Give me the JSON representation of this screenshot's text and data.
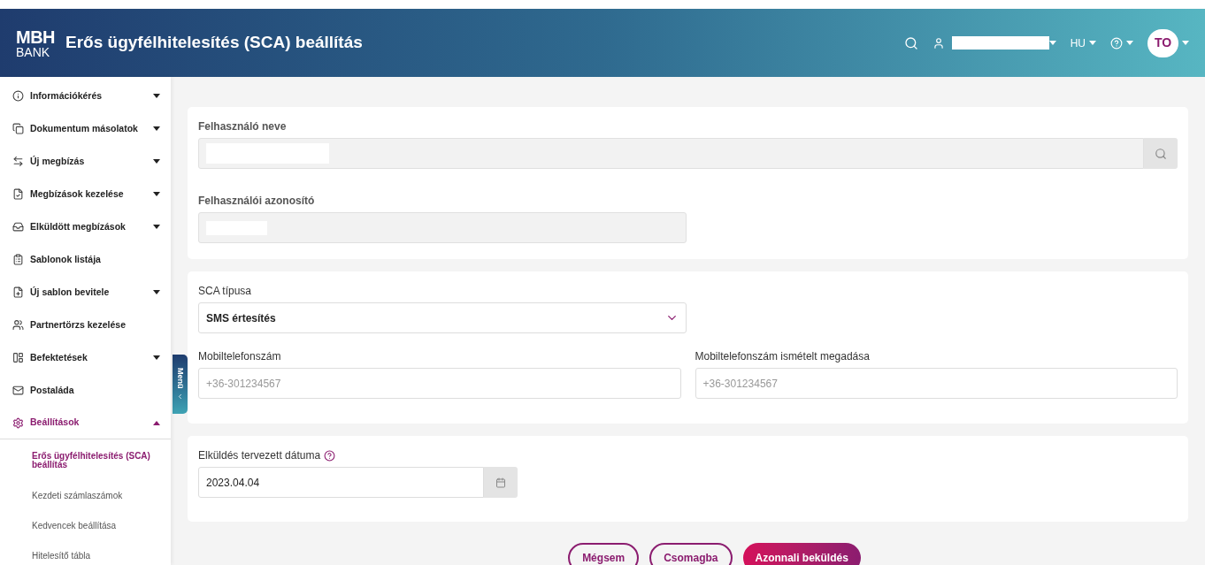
{
  "header": {
    "logo_top": "MBH",
    "logo_bottom": "BANK",
    "title": "Erős ügyfélhitelesítés (SCA) beállítás",
    "language": "HU",
    "avatar": "TO"
  },
  "sidebar": {
    "items": [
      {
        "label": "Információkérés",
        "kind": "group",
        "expanded": false
      },
      {
        "label": "Dokumentum másolatok",
        "kind": "group",
        "expanded": false
      },
      {
        "label": "Új megbízás",
        "kind": "group",
        "expanded": false
      },
      {
        "label": "Megbízások kezelése",
        "kind": "group",
        "expanded": false
      },
      {
        "label": "Elküldött megbízások",
        "kind": "group",
        "expanded": false
      },
      {
        "label": "Sablonok listája",
        "kind": "link"
      },
      {
        "label": "Új sablon bevitele",
        "kind": "group",
        "expanded": false
      },
      {
        "label": "Partnertörzs kezelése",
        "kind": "link"
      },
      {
        "label": "Befektetések",
        "kind": "group",
        "expanded": false
      },
      {
        "label": "Postaláda",
        "kind": "link"
      },
      {
        "label": "Beállítások",
        "kind": "group",
        "expanded": true,
        "children": [
          {
            "label": "Erős ügyfélhitelesítés (SCA) beállítás",
            "selected": true
          },
          {
            "label": "Kezdeti számlaszámok",
            "selected": false
          },
          {
            "label": "Kedvencek beállítása",
            "selected": false
          },
          {
            "label": "Hitelesítő tábla",
            "selected": false
          }
        ]
      }
    ],
    "toggle": "Menü"
  },
  "user_card": {
    "name_label": "Felhasználó neve",
    "id_label": "Felhasználói azonosító"
  },
  "sca_card": {
    "type_label": "SCA típusa",
    "type_value": "SMS értesítés",
    "phone_label": "Mobiltelefonszám",
    "phone_placeholder": "+36-301234567",
    "phone_repeat_label": "Mobiltelefonszám ismételt megadása",
    "phone_repeat_placeholder": "+36-301234567"
  },
  "date_card": {
    "label": "Elküldés tervezett dátuma",
    "value": "2023.04.04"
  },
  "buttons": [
    {
      "label": "Mégsem",
      "kind": "outline"
    },
    {
      "label": "Csomagba",
      "kind": "outline"
    },
    {
      "label": "Azonnali beküldés",
      "kind": "primary"
    }
  ]
}
